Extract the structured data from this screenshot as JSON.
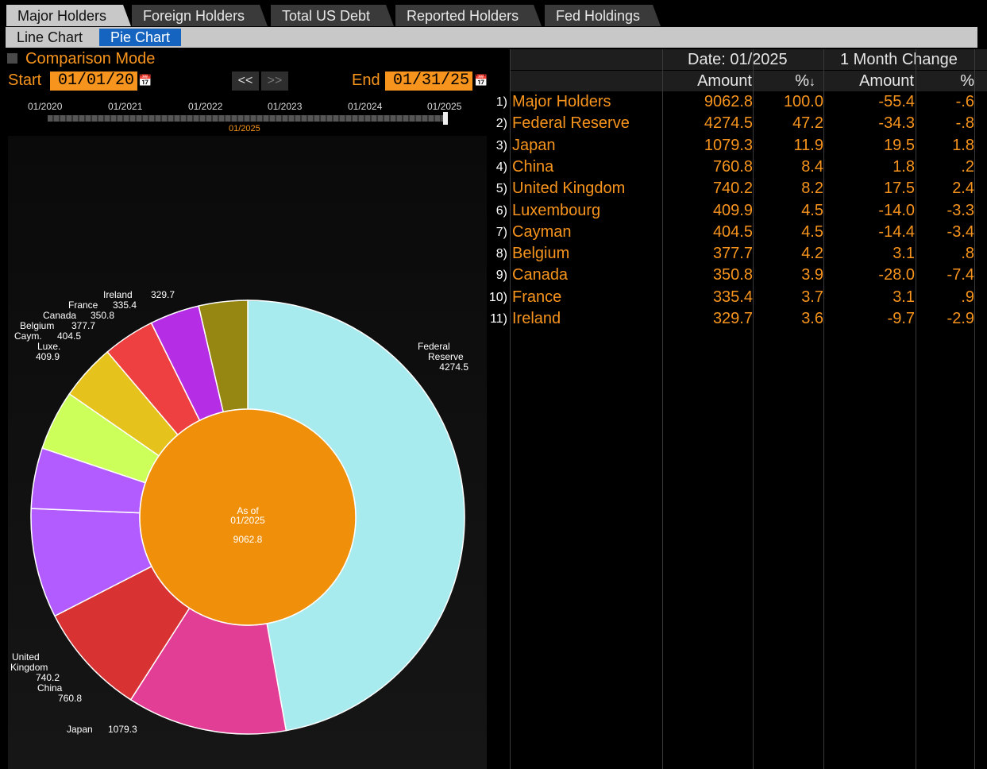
{
  "tabs": [
    "Major Holders",
    "Foreign Holders",
    "Total US Debt",
    "Reported Holders",
    "Fed Holdings"
  ],
  "subtabs": [
    "Line Chart",
    "Pie Chart"
  ],
  "controls": {
    "comparison_mode": "Comparison Mode",
    "start_label": "Start",
    "start_value": "01/01/20",
    "end_label": "End",
    "end_value": "01/31/25",
    "prev_label": "<<",
    "next_label": ">>"
  },
  "timeline": {
    "ticks": [
      "01/2020",
      "01/2021",
      "01/2022",
      "01/2023",
      "01/2024",
      "01/2025"
    ],
    "selected": "01/2025",
    "position": 1.0
  },
  "chart_data": {
    "type": "pie",
    "center_label_1": "As of",
    "center_label_2": "01/2025",
    "center_value": "9062.8",
    "total_value": 9062.8,
    "center_color": "#f0900a",
    "slices": [
      {
        "name": "Federal Reserve",
        "value": 4274.5,
        "color": "#a8ebef",
        "label": "Federal\nReserve",
        "value_label": "4274.5"
      },
      {
        "name": "Japan",
        "value": 1079.3,
        "color": "#e23e96",
        "label": "Japan",
        "value_label": "1079.3"
      },
      {
        "name": "China",
        "value": 760.8,
        "color": "#d93232",
        "label": "China",
        "value_label": "760.8"
      },
      {
        "name": "United Kingdom",
        "value": 740.2,
        "color": "#b25cff",
        "label": "United\nKingdom",
        "value_label": "740.2"
      },
      {
        "name": "Luxembourg",
        "value": 409.9,
        "color": "#b25cff",
        "label": "Luxe.",
        "value_label": "409.9"
      },
      {
        "name": "Cayman",
        "value": 404.5,
        "color": "#ccff5a",
        "label": "Caym.",
        "value_label": "404.5"
      },
      {
        "name": "Belgium",
        "value": 377.7,
        "color": "#e6c21c",
        "label": "Belgium",
        "value_label": "377.7"
      },
      {
        "name": "Canada",
        "value": 350.8,
        "color": "#ee4040",
        "label": "Canada",
        "value_label": "350.8"
      },
      {
        "name": "France",
        "value": 335.4,
        "color": "#b52ee6",
        "label": "France",
        "value_label": "335.4"
      },
      {
        "name": "Ireland",
        "value": 329.7,
        "color": "#958712",
        "label": "Ireland",
        "value_label": "329.7"
      }
    ]
  },
  "table": {
    "header_date": "Date: 01/2025",
    "header_change": "1 Month Change",
    "columns": [
      "Amount",
      "%",
      "Amount",
      "%"
    ],
    "rows": [
      {
        "idx": "1)",
        "name": "Major Holders",
        "amount": "9062.8",
        "pct": "100.0",
        "chg_amount": "-55.4",
        "chg_pct": "-.6"
      },
      {
        "idx": "2)",
        "name": "Federal Reserve",
        "amount": "4274.5",
        "pct": "47.2",
        "chg_amount": "-34.3",
        "chg_pct": "-.8"
      },
      {
        "idx": "3)",
        "name": "Japan",
        "amount": "1079.3",
        "pct": "11.9",
        "chg_amount": "19.5",
        "chg_pct": "1.8"
      },
      {
        "idx": "4)",
        "name": "China",
        "amount": "760.8",
        "pct": "8.4",
        "chg_amount": "1.8",
        "chg_pct": ".2"
      },
      {
        "idx": "5)",
        "name": "United Kingdom",
        "amount": "740.2",
        "pct": "8.2",
        "chg_amount": "17.5",
        "chg_pct": "2.4"
      },
      {
        "idx": "6)",
        "name": "Luxembourg",
        "amount": "409.9",
        "pct": "4.5",
        "chg_amount": "-14.0",
        "chg_pct": "-3.3"
      },
      {
        "idx": "7)",
        "name": "Cayman",
        "amount": "404.5",
        "pct": "4.5",
        "chg_amount": "-14.4",
        "chg_pct": "-3.4"
      },
      {
        "idx": "8)",
        "name": "Belgium",
        "amount": "377.7",
        "pct": "4.2",
        "chg_amount": "3.1",
        "chg_pct": ".8"
      },
      {
        "idx": "9)",
        "name": "Canada",
        "amount": "350.8",
        "pct": "3.9",
        "chg_amount": "-28.0",
        "chg_pct": "-7.4"
      },
      {
        "idx": "10)",
        "name": "France",
        "amount": "335.4",
        "pct": "3.7",
        "chg_amount": "3.1",
        "chg_pct": ".9"
      },
      {
        "idx": "11)",
        "name": "Ireland",
        "amount": "329.7",
        "pct": "3.6",
        "chg_amount": "-9.7",
        "chg_pct": "-2.9"
      }
    ]
  }
}
